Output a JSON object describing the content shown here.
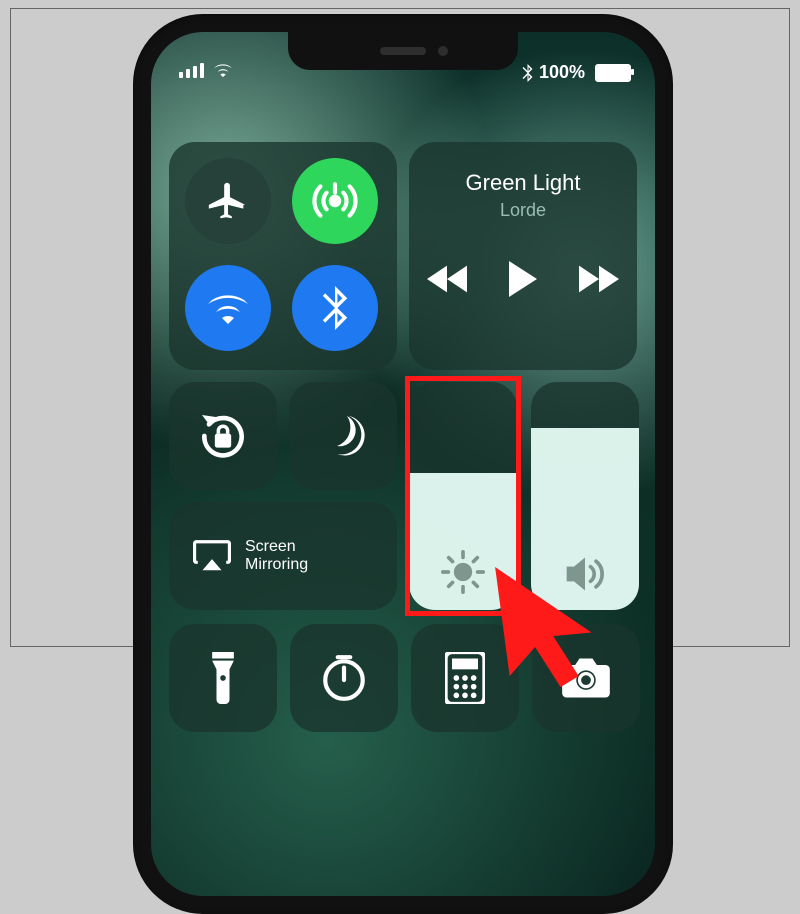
{
  "statusbar": {
    "battery_label": "100%",
    "battery_pct": 100
  },
  "connectivity": {
    "airplane_name": "airplane-icon",
    "airdrop_name": "airdrop-icon",
    "wifi_name": "wifi-icon",
    "bluetooth_name": "bluetooth-icon"
  },
  "music": {
    "title": "Green Light",
    "artist": "Lorde"
  },
  "screenMirroring": {
    "label": "Screen\nMirroring"
  },
  "sliders": {
    "brightness_pct": 60,
    "volume_pct": 80
  },
  "colors": {
    "green": "#2fd65c",
    "blue": "#1f7af2",
    "tile": "rgba(26,52,45,.78)",
    "highlight": "#ff1a1a"
  }
}
